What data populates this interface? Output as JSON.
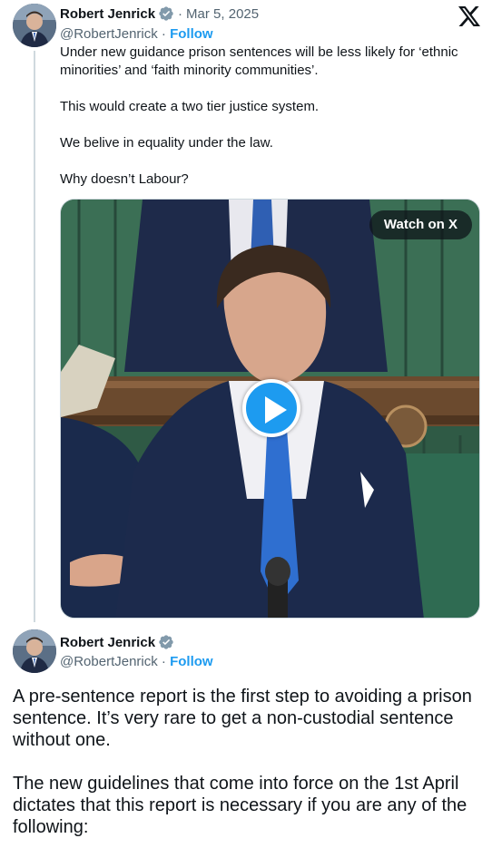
{
  "tweet1": {
    "author_name": "Robert Jenrick",
    "verified_icon": "verified-badge",
    "separator": "·",
    "date": "Mar 5, 2025",
    "handle": "@RobertJenrick",
    "handle_sep": " · ",
    "follow_label": "Follow",
    "platform_icon": "x-logo",
    "paragraphs": [
      "Under new guidance prison sentences will be less likely for ‘ethnic minorities’ and ‘faith minority communities’.",
      "This would create a two tier justice system.",
      "We belive in equality under the law.",
      "Why doesn’t Labour?"
    ],
    "media": {
      "watch_label": "Watch on X",
      "play_icon": "play-icon"
    }
  },
  "tweet2": {
    "author_name": "Robert Jenrick",
    "verified_icon": "verified-badge",
    "handle": "@RobertJenrick",
    "handle_sep": " · ",
    "follow_label": "Follow",
    "paragraphs": [
      "A pre-sentence report is the first step to avoiding a prison sentence. It’s very rare to get a non-custodial sentence without one.",
      "The new guidelines that come into force on the 1st April dictates that this report is necessary if you are any of the following:"
    ]
  },
  "colors": {
    "accent": "#1d9bf0",
    "secondary_text": "#536471",
    "primary_text": "#0f1419",
    "thread_line": "#cfd9de"
  }
}
